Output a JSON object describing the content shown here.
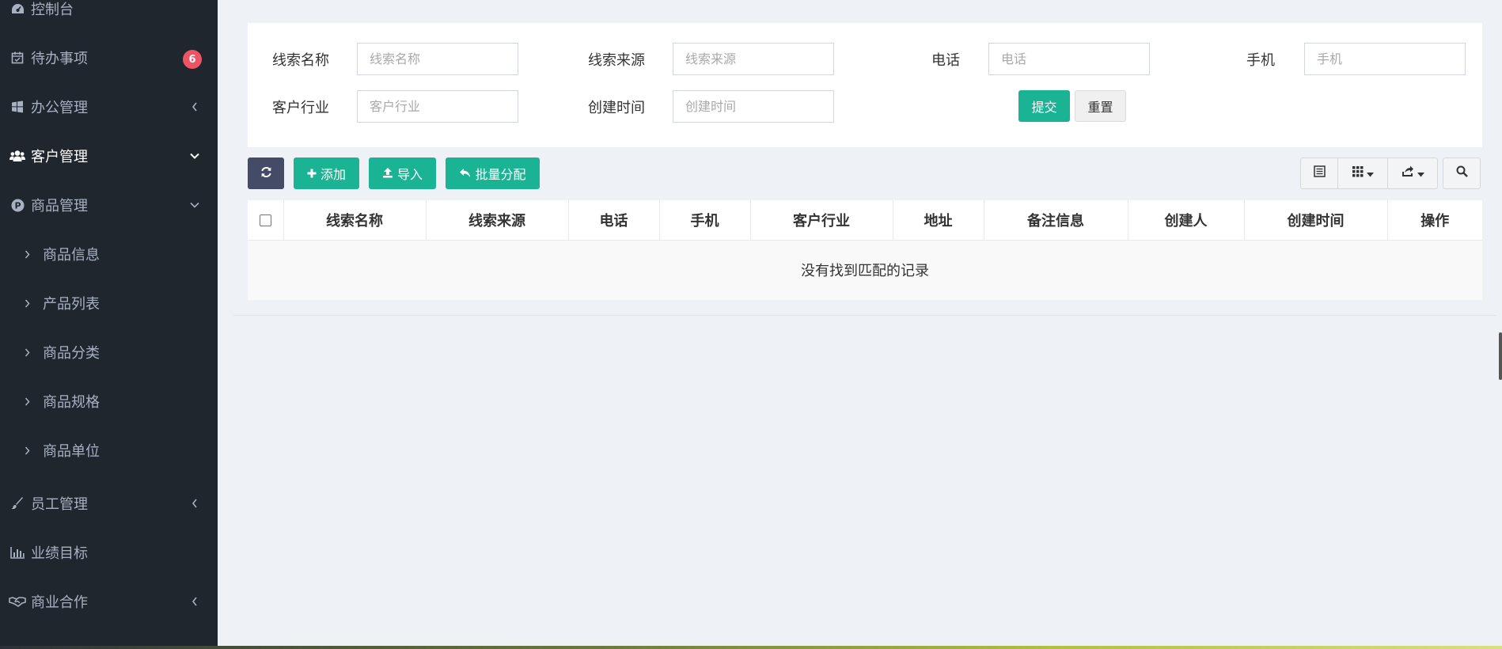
{
  "sidebar": {
    "items": [
      {
        "label": "控制台",
        "icon": "dashboard-icon"
      },
      {
        "label": "待办事项",
        "icon": "calendar-check-icon",
        "badge": "6"
      },
      {
        "label": "办公管理",
        "icon": "windows-icon"
      },
      {
        "label": "客户管理",
        "icon": "users-icon"
      },
      {
        "label": "商品管理",
        "icon": "product-p-icon"
      },
      {
        "label": "员工管理",
        "icon": "brush-icon"
      },
      {
        "label": "业绩目标",
        "icon": "bar-chart-icon"
      },
      {
        "label": "商业合作",
        "icon": "handshake-icon"
      }
    ],
    "sub_items": [
      {
        "label": "商品信息"
      },
      {
        "label": "产品列表"
      },
      {
        "label": "商品分类"
      },
      {
        "label": "商品规格"
      },
      {
        "label": "商品单位"
      }
    ]
  },
  "search": {
    "fields": [
      {
        "label": "线索名称",
        "placeholder": "线索名称"
      },
      {
        "label": "线索来源",
        "placeholder": "线索来源"
      },
      {
        "label": "电话",
        "placeholder": "电话"
      },
      {
        "label": "手机",
        "placeholder": "手机"
      },
      {
        "label": "客户行业",
        "placeholder": "客户行业"
      },
      {
        "label": "创建时间",
        "placeholder": "创建时间"
      }
    ],
    "submit_label": "提交",
    "reset_label": "重置"
  },
  "toolbar": {
    "add_label": "添加",
    "import_label": "导入",
    "batch_label": "批量分配"
  },
  "table": {
    "columns": [
      "线索名称",
      "线索来源",
      "电话",
      "手机",
      "客户行业",
      "地址",
      "备注信息",
      "创建人",
      "创建时间",
      "操作"
    ],
    "empty_text": "没有找到匹配的记录"
  },
  "colors": {
    "sidebar_bg": "#1f262d",
    "accent": "#1ab394",
    "refresh_btn": "#434b66",
    "badge": "#ed5565"
  }
}
